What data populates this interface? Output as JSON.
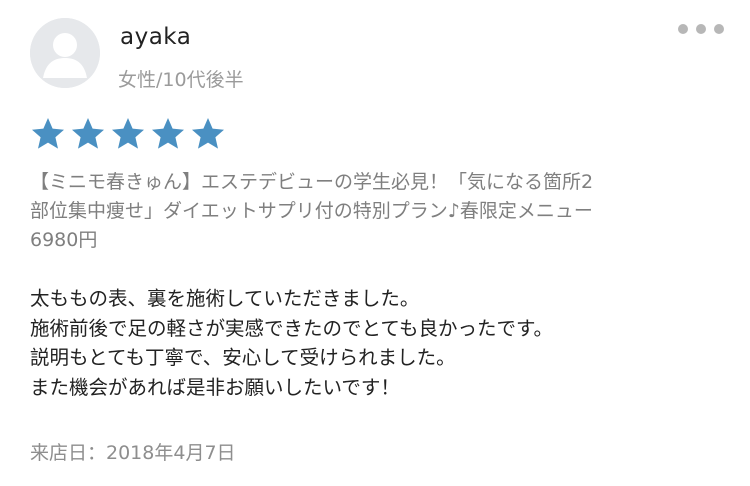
{
  "reviewer": {
    "avatar_icon": "user-silhouette-icon",
    "name": "ayaka",
    "meta": "女性/10代後半"
  },
  "menu": {
    "icon": "more-horizontal-icon"
  },
  "rating": {
    "value": 5,
    "max": 5,
    "star_color": "#4a90c2"
  },
  "plan_text": "【ミニモ春きゅん】エステデビューの学生必見！「気になる箇所2\n部位集中痩せ」ダイエットサプリ付の特別プラン♪春限定メニュー\n6980円",
  "comment": "太ももの表、裏を施術していただきました。\n施術前後で足の軽さが実感できたのでとても良かったです。\n説明もとても丁寧で、安心して受けられました。\nまた機会があれば是非お願いしたいです！",
  "visit_date": "来店日：2018年4月7日"
}
